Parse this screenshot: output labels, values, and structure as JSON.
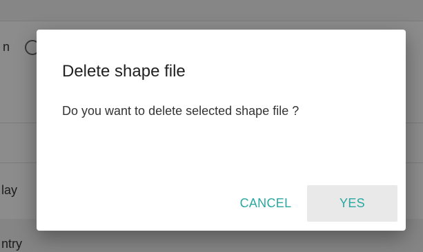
{
  "background": {
    "row_labels": [
      "n",
      "lay",
      "ntry"
    ]
  },
  "dialog": {
    "title": "Delete shape file",
    "message": "Do you want to delete selected shape file ?",
    "cancel_label": "CANCEL",
    "confirm_label": "YES",
    "accent_color": "#2aa7a0"
  }
}
